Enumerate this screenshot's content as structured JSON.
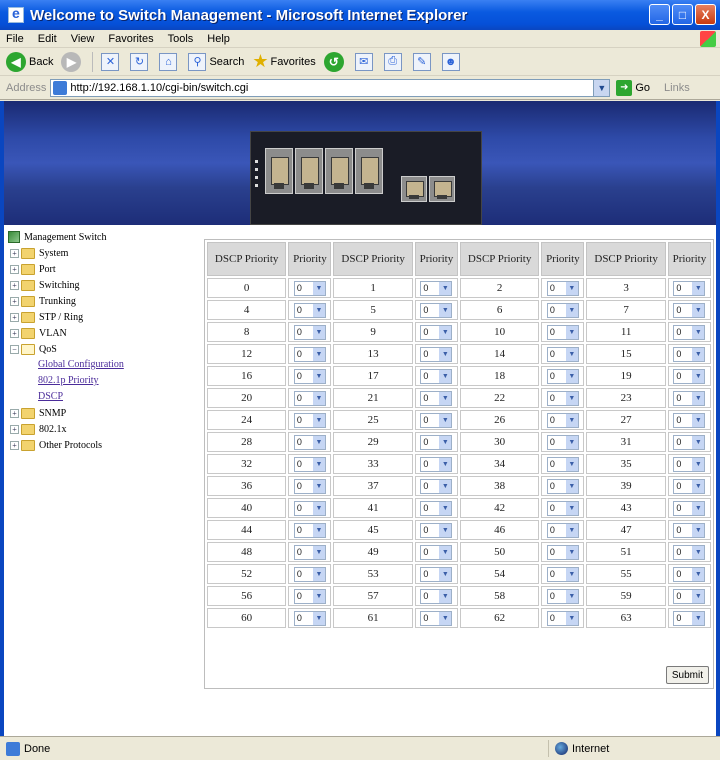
{
  "window": {
    "title": "Welcome to Switch Management - Microsoft Internet Explorer",
    "buttons": [
      "_",
      "□",
      "X"
    ]
  },
  "menu": [
    "File",
    "Edit",
    "View",
    "Favorites",
    "Tools",
    "Help"
  ],
  "toolbar": {
    "back_label": "Back",
    "search_label": "Search",
    "favorites_label": "Favorites"
  },
  "address": {
    "label": "Address",
    "url": "http://192.168.1.10/cgi-bin/switch.cgi",
    "go_label": "Go",
    "links_label": "Links"
  },
  "sidebar": {
    "root": "Management Switch",
    "items_top": [
      {
        "label": "System"
      },
      {
        "label": "Port"
      },
      {
        "label": "Switching"
      },
      {
        "label": "Trunking"
      },
      {
        "label": "STP / Ring"
      },
      {
        "label": "VLAN"
      }
    ],
    "qos": {
      "label": "QoS",
      "children": [
        "Global Configuration",
        "802.1p Priority",
        "DSCP"
      ]
    },
    "items_bottom": [
      {
        "label": "SNMP"
      },
      {
        "label": "802.1x"
      },
      {
        "label": "Other Protocols"
      }
    ]
  },
  "dscp": {
    "header_dscp": "DSCP Priority",
    "header_priority": "Priority",
    "default_priority": "0",
    "values": [
      0,
      1,
      2,
      3,
      4,
      5,
      6,
      7,
      8,
      9,
      10,
      11,
      12,
      13,
      14,
      15,
      16,
      17,
      18,
      19,
      20,
      21,
      22,
      23,
      24,
      25,
      26,
      27,
      28,
      29,
      30,
      31,
      32,
      33,
      34,
      35,
      36,
      37,
      38,
      39,
      40,
      41,
      42,
      43,
      44,
      45,
      46,
      47,
      48,
      49,
      50,
      51,
      52,
      53,
      54,
      55,
      56,
      57,
      58,
      59,
      60,
      61,
      62,
      63
    ],
    "submit_label": "Submit"
  },
  "status": {
    "left": "Done",
    "zone": "Internet"
  },
  "colors": {
    "titlebar": "#0550d8",
    "banner": "#2e4aa8",
    "table_header": "#d9d9d9",
    "link": "#4b2c9a"
  }
}
